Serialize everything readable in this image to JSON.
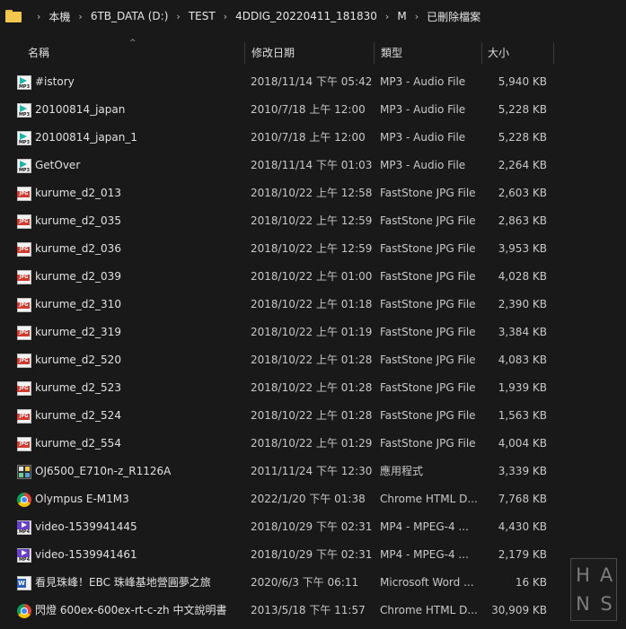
{
  "breadcrumb": [
    "本機",
    "6TB_DATA (D:)",
    "TEST",
    "4DDIG_20220411_181830",
    "M",
    "已刪除檔案"
  ],
  "columns": {
    "name": "名稱",
    "date": "修改日期",
    "type": "類型",
    "size": "大小"
  },
  "files": [
    {
      "icon": "mp3",
      "name": "#istory",
      "date": "2018/11/14 下午 05:42",
      "type": "MP3 - Audio File",
      "size": "5,940 KB"
    },
    {
      "icon": "mp3",
      "name": "20100814_japan",
      "date": "2010/7/18 上午 12:00",
      "type": "MP3 - Audio File",
      "size": "5,228 KB"
    },
    {
      "icon": "mp3",
      "name": "20100814_japan_1",
      "date": "2010/7/18 上午 12:00",
      "type": "MP3 - Audio File",
      "size": "5,228 KB"
    },
    {
      "icon": "mp3",
      "name": "GetOver",
      "date": "2018/11/14 下午 01:03",
      "type": "MP3 - Audio File",
      "size": "2,264 KB"
    },
    {
      "icon": "jpg",
      "name": "kurume_d2_013",
      "date": "2018/10/22 上午 12:58",
      "type": "FastStone JPG File",
      "size": "2,603 KB"
    },
    {
      "icon": "jpg",
      "name": "kurume_d2_035",
      "date": "2018/10/22 上午 12:59",
      "type": "FastStone JPG File",
      "size": "2,863 KB"
    },
    {
      "icon": "jpg",
      "name": "kurume_d2_036",
      "date": "2018/10/22 上午 12:59",
      "type": "FastStone JPG File",
      "size": "3,953 KB"
    },
    {
      "icon": "jpg",
      "name": "kurume_d2_039",
      "date": "2018/10/22 上午 01:00",
      "type": "FastStone JPG File",
      "size": "4,028 KB"
    },
    {
      "icon": "jpg",
      "name": "kurume_d2_310",
      "date": "2018/10/22 上午 01:18",
      "type": "FastStone JPG File",
      "size": "2,390 KB"
    },
    {
      "icon": "jpg",
      "name": "kurume_d2_319",
      "date": "2018/10/22 上午 01:19",
      "type": "FastStone JPG File",
      "size": "3,384 KB"
    },
    {
      "icon": "jpg",
      "name": "kurume_d2_520",
      "date": "2018/10/22 上午 01:28",
      "type": "FastStone JPG File",
      "size": "4,083 KB"
    },
    {
      "icon": "jpg",
      "name": "kurume_d2_523",
      "date": "2018/10/22 上午 01:28",
      "type": "FastStone JPG File",
      "size": "1,939 KB"
    },
    {
      "icon": "jpg",
      "name": "kurume_d2_524",
      "date": "2018/10/22 上午 01:28",
      "type": "FastStone JPG File",
      "size": "1,563 KB"
    },
    {
      "icon": "jpg",
      "name": "kurume_d2_554",
      "date": "2018/10/22 上午 01:29",
      "type": "FastStone JPG File",
      "size": "4,004 KB"
    },
    {
      "icon": "exe",
      "name": "OJ6500_E710n-z_R1126A",
      "date": "2011/11/24 下午 12:30",
      "type": "應用程式",
      "size": "3,339 KB"
    },
    {
      "icon": "chrome",
      "name": "Olympus E-M1M3",
      "date": "2022/1/20 下午 01:38",
      "type": "Chrome HTML D...",
      "size": "7,768 KB"
    },
    {
      "icon": "mp4",
      "name": "video-1539941445",
      "date": "2018/10/29 下午 02:31",
      "type": "MP4 - MPEG-4 ...",
      "size": "4,430 KB"
    },
    {
      "icon": "mp4",
      "name": "video-1539941461",
      "date": "2018/10/29 下午 02:31",
      "type": "MP4 - MPEG-4 ...",
      "size": "2,179 KB"
    },
    {
      "icon": "word",
      "name": "看見珠峰！EBC 珠峰基地營圓夢之旅",
      "date": "2020/6/3 下午 06:11",
      "type": "Microsoft Word ...",
      "size": "16 KB"
    },
    {
      "icon": "chrome",
      "name": "閃燈 600ex-600ex-rt-c-zh 中文說明書",
      "date": "2013/5/18 下午 11:57",
      "type": "Chrome HTML D...",
      "size": "30,909 KB"
    }
  ],
  "watermark": [
    "H",
    "A",
    "N",
    "S"
  ],
  "colors": {
    "background": "#191919",
    "folder": "#f3c64f",
    "mp3": "#1fb5a6",
    "jpg": "#d13a2f",
    "mp4": "#6a3fc8",
    "word": "#2b5fb8"
  }
}
